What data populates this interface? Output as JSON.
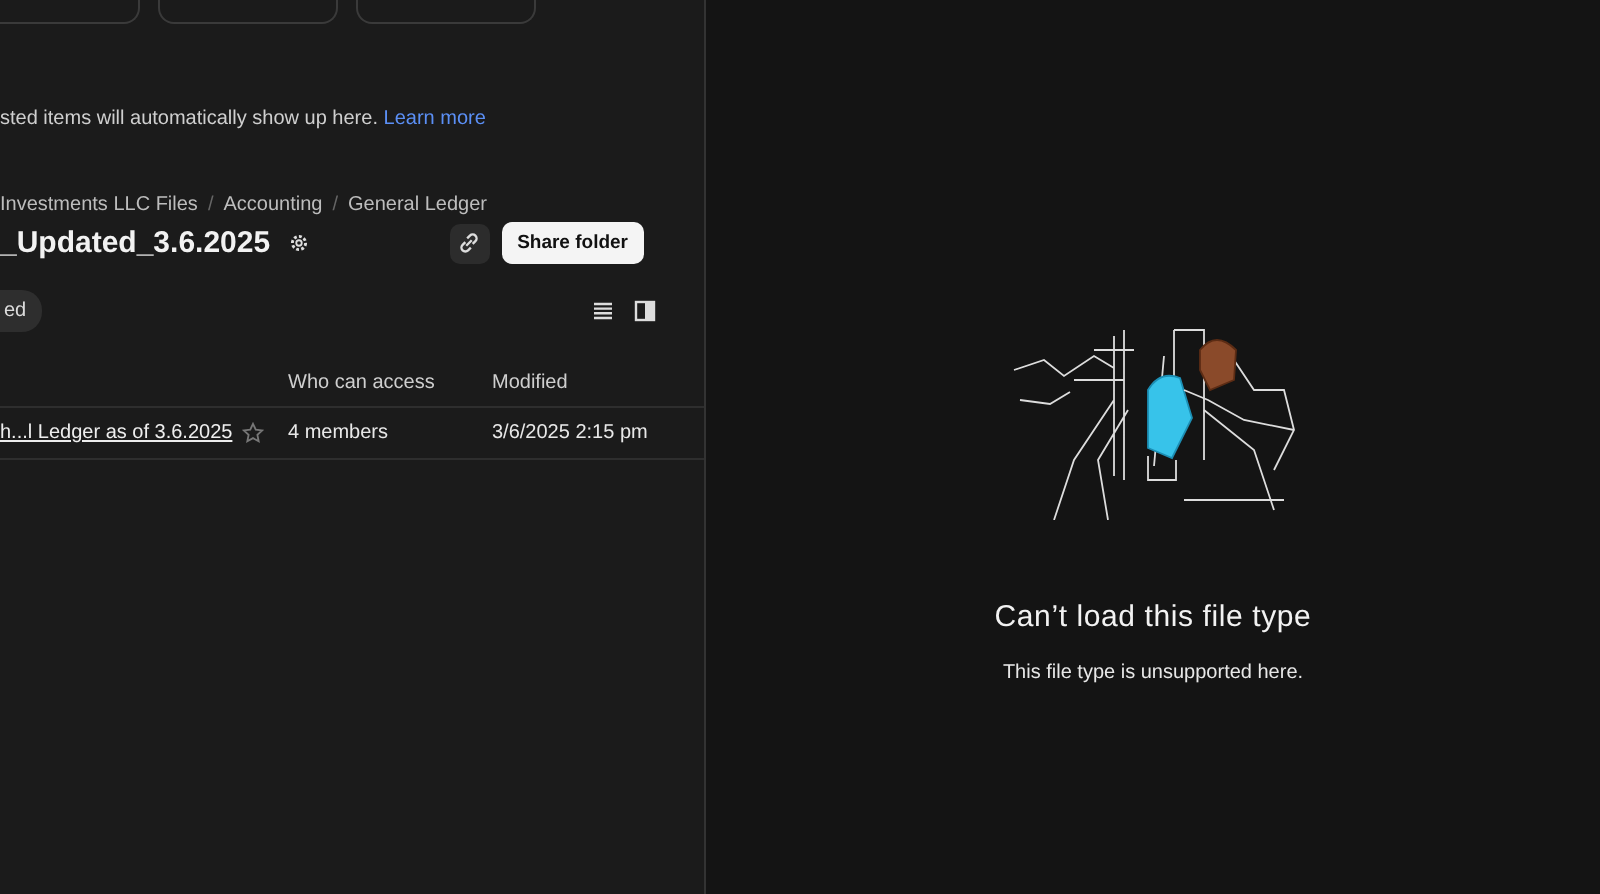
{
  "top_actions": [
    {
      "kind": "outline"
    },
    {
      "kind": "outline"
    },
    {
      "kind": "outline"
    }
  ],
  "help": {
    "text": "sted items will automatically show up here.",
    "link": "Learn more"
  },
  "breadcrumb": {
    "separator": "/",
    "items": [
      "Investments LLC Files",
      "Accounting",
      "General Ledger"
    ]
  },
  "folder": {
    "title": "_Updated_3.6.2025",
    "share_button": "Share folder"
  },
  "filter_chip": {
    "label": "ed",
    "selected": true
  },
  "table": {
    "columns": [
      "Who can access",
      "Modified"
    ],
    "rows": [
      {
        "name": "h...l Ledger as of 3.6.2025",
        "starred": false,
        "access": "4 members",
        "modified": "3/6/2025 2:15 pm"
      }
    ]
  },
  "preview": {
    "heading": "Can’t load this file type",
    "message": "This file type is unsupported here."
  }
}
